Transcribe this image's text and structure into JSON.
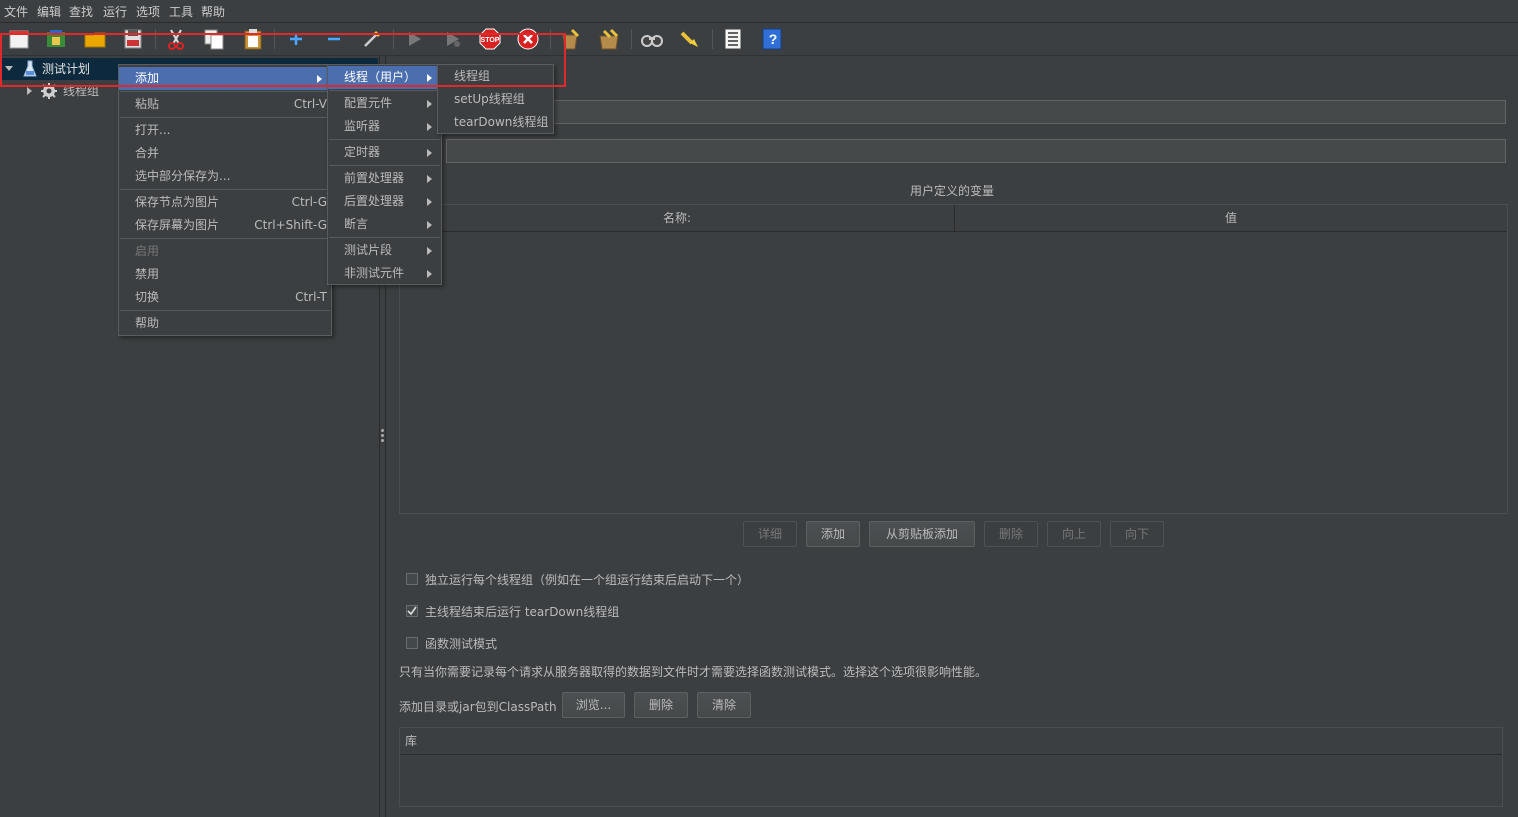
{
  "menubar": {
    "items": [
      "文件",
      "编辑",
      "查找",
      "运行",
      "选项",
      "工具",
      "帮助"
    ]
  },
  "toolbar": {
    "icons": [
      "new-icon",
      "templates-icon",
      "open-icon",
      "save-icon",
      "cut-icon",
      "copy-icon",
      "paste-icon",
      "expand-icon",
      "collapse-icon",
      "toggle-icon",
      "start-icon",
      "start-no-pause-icon",
      "stop-icon",
      "shutdown-icon",
      "clear-icon",
      "clear-all-icon",
      "search-icon",
      "reset-search-icon",
      "function-helper-icon",
      "help-icon"
    ]
  },
  "tree": {
    "root": "测试计划",
    "child": "线程组"
  },
  "context_menu": {
    "items": [
      {
        "label": "添加",
        "shortcut": ""
      },
      {
        "label": "粘贴",
        "shortcut": "Ctrl-V"
      },
      {
        "label": "打开...",
        "shortcut": ""
      },
      {
        "label": "合并",
        "shortcut": ""
      },
      {
        "label": "选中部分保存为...",
        "shortcut": ""
      },
      {
        "label": "保存节点为图片",
        "shortcut": "Ctrl-G"
      },
      {
        "label": "保存屏幕为图片",
        "shortcut": "Ctrl+Shift-G"
      },
      {
        "label": "启用",
        "shortcut": ""
      },
      {
        "label": "禁用",
        "shortcut": ""
      },
      {
        "label": "切换",
        "shortcut": "Ctrl-T"
      },
      {
        "label": "帮助",
        "shortcut": ""
      }
    ]
  },
  "add_submenu": {
    "items": [
      "线程（用户）",
      "配置元件",
      "监听器",
      "定时器",
      "前置处理器",
      "后置处理器",
      "断言",
      "测试片段",
      "非测试元件"
    ]
  },
  "thread_submenu": {
    "items": [
      "线程组",
      "setUp线程组",
      "tearDown线程组"
    ]
  },
  "main": {
    "variables_title": "用户定义的变量",
    "col_name": "名称:",
    "col_value": "值",
    "buttons": {
      "detail": "详细",
      "add": "添加",
      "add_clipboard": "从剪贴板添加",
      "delete": "删除",
      "up": "向上",
      "down": "向下"
    },
    "checks": {
      "serialize": {
        "label": "独立运行每个线程组（例如在一个组运行结束后启动下一个）",
        "checked": false
      },
      "teardown": {
        "label": "主线程结束后运行 tearDown线程组",
        "checked": true
      },
      "functional": {
        "label": "函数测试模式",
        "checked": false
      }
    },
    "functional_note": "只有当你需要记录每个请求从服务器取得的数据到文件时才需要选择函数测试模式。选择这个选项很影响性能。",
    "classpath_label": "添加目录或jar包到ClassPath",
    "classpath_buttons": {
      "browse": "浏览...",
      "delete": "删除",
      "clear": "清除"
    },
    "library_header": "库"
  }
}
